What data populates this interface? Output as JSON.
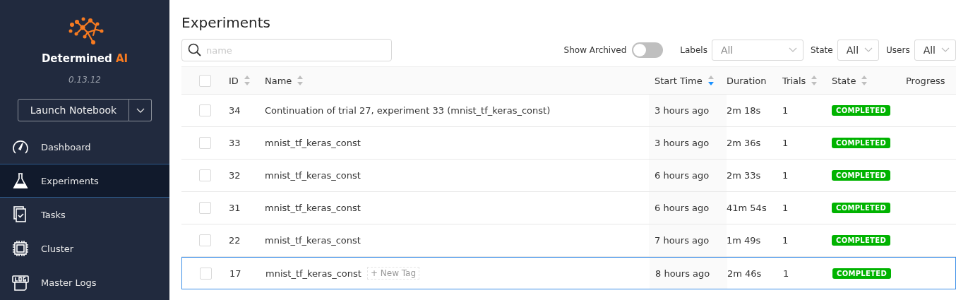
{
  "sidebar": {
    "brand": {
      "name": "Determined",
      "suffix": "AI"
    },
    "version": "0.13.12",
    "launch_button": "Launch Notebook",
    "items": [
      {
        "label": "Dashboard",
        "selected": false
      },
      {
        "label": "Experiments",
        "selected": true
      },
      {
        "label": "Tasks",
        "selected": false
      },
      {
        "label": "Cluster",
        "selected": false
      },
      {
        "label": "Master Logs",
        "selected": false
      }
    ]
  },
  "page_title": "Experiments",
  "search": {
    "placeholder": "name"
  },
  "filters": {
    "show_archived": {
      "label": "Show Archived",
      "on": false
    },
    "selects": [
      {
        "label": "Labels",
        "value": "All"
      },
      {
        "label": "State",
        "value": "All"
      },
      {
        "label": "Users",
        "value": "All"
      }
    ]
  },
  "table": {
    "select_all": {
      "checked": false
    },
    "columns": [
      {
        "label": "ID",
        "sortable": true
      },
      {
        "label": "Name",
        "sortable": true
      },
      {
        "label": "Start Time",
        "sortable": true,
        "sorted": true
      },
      {
        "label": "Duration",
        "sortable": false
      },
      {
        "label": "Trials",
        "sortable": true
      },
      {
        "label": "State",
        "sortable": true
      },
      {
        "label": "Progress",
        "sortable": false
      }
    ],
    "rows": [
      {
        "id": "34",
        "name": "Continuation of trial 27, experiment 33 (mnist_tf_keras_const)",
        "start": "3 hours ago",
        "duration": "2m 18s",
        "trials": "1",
        "state": "COMPLETED",
        "checked": false,
        "highlighted": false
      },
      {
        "id": "33",
        "name": "mnist_tf_keras_const",
        "start": "3 hours ago",
        "duration": "2m 36s",
        "trials": "1",
        "state": "COMPLETED",
        "checked": false,
        "highlighted": false
      },
      {
        "id": "32",
        "name": "mnist_tf_keras_const",
        "start": "6 hours ago",
        "duration": "2m 33s",
        "trials": "1",
        "state": "COMPLETED",
        "checked": false,
        "highlighted": false
      },
      {
        "id": "31",
        "name": "mnist_tf_keras_const",
        "start": "6 hours ago",
        "duration": "41m 54s",
        "trials": "1",
        "state": "COMPLETED",
        "checked": false,
        "highlighted": false
      },
      {
        "id": "22",
        "name": "mnist_tf_keras_const",
        "start": "7 hours ago",
        "duration": "1m 49s",
        "trials": "1",
        "state": "COMPLETED",
        "checked": false,
        "highlighted": false
      },
      {
        "id": "17",
        "name": "mnist_tf_keras_const",
        "tag_action": "+ New Tag",
        "start": "8 hours ago",
        "duration": "2m 46s",
        "trials": "1",
        "state": "COMPLETED",
        "checked": false,
        "highlighted": true
      }
    ]
  }
}
